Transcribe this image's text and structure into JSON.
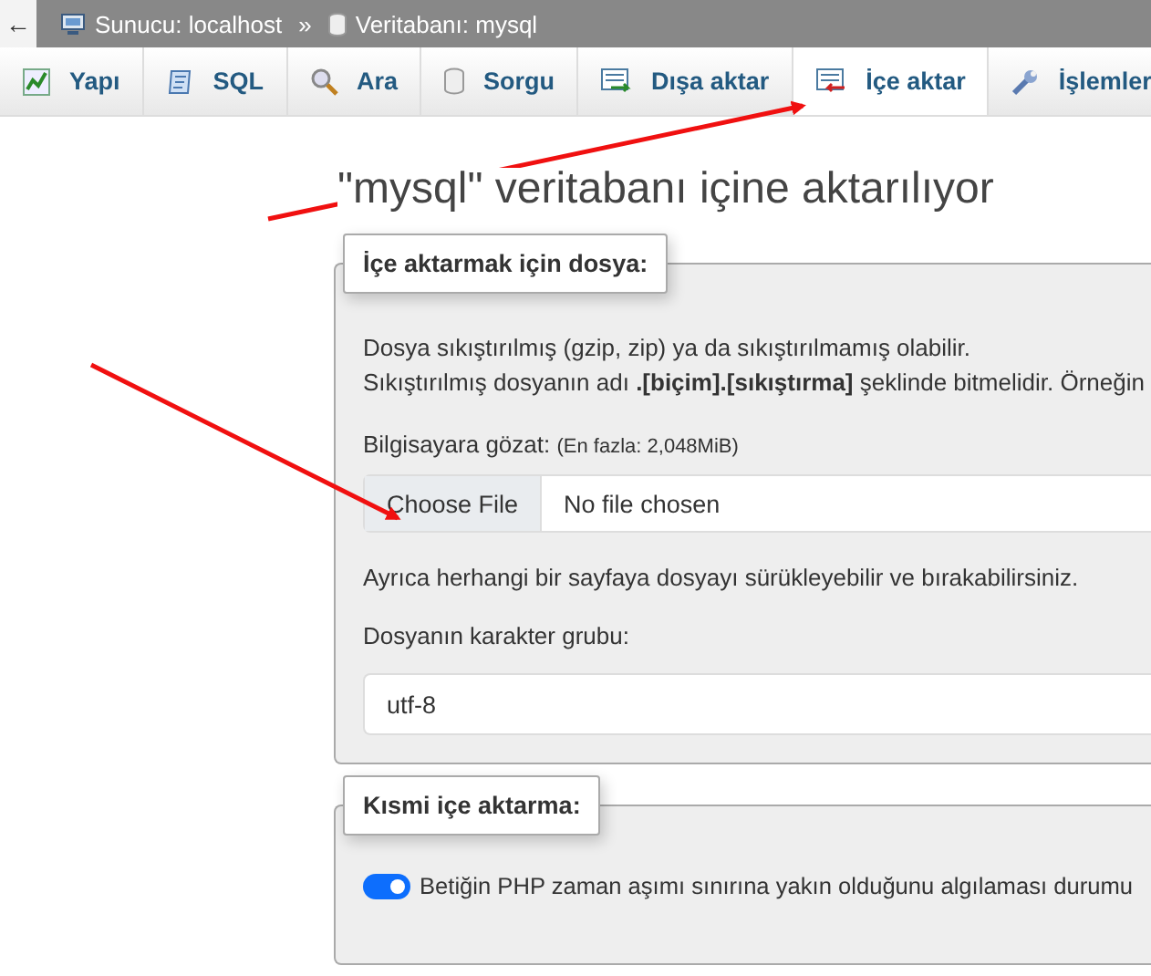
{
  "breadcrumb": {
    "back": "←",
    "server": "Sunucu: localhost",
    "separator": "»",
    "database": "Veritabanı: mysql"
  },
  "tabs": [
    {
      "label": "Yapı",
      "kind": "structure",
      "selected": false
    },
    {
      "label": "SQL",
      "kind": "sql",
      "selected": false
    },
    {
      "label": "Ara",
      "kind": "search",
      "selected": false
    },
    {
      "label": "Sorgu",
      "kind": "query",
      "selected": false
    },
    {
      "label": "Dışa aktar",
      "kind": "export",
      "selected": false
    },
    {
      "label": "İçe aktar",
      "kind": "import",
      "selected": true
    },
    {
      "label": "İşlemler",
      "kind": "operations",
      "selected": false
    }
  ],
  "page_title": "\"mysql\" veritabanı içine aktarılıyor",
  "file_section": {
    "legend": "İçe aktarmak için dosya:",
    "lines": [
      "Dosya sıkıştırılmış (gzip, zip) ya da sıkıştırılmamış olabilir.",
      "Sıkıştırılmış dosyanın adı **.[biçim].[sıkıştırma]** şeklinde bitmelidir. Örneğin"
    ],
    "browse_label": "Bilgisayara gözat:",
    "browse_limit": "(En fazla: 2,048MiB)",
    "choose_button": "Choose File",
    "file_status": "No file chosen",
    "drag_note": "Ayrıca herhangi bir sayfaya dosyayı sürükleyebilir ve bırakabilirsiniz.",
    "charset_label": "Dosyanın karakter grubu:",
    "charset_value": "utf-8"
  },
  "partial_section": {
    "legend": "Kısmi içe aktarma:",
    "toggle": {
      "on": true,
      "label": "Betiğin PHP zaman aşımı sınırına yakın olduğunu algılaması durumu"
    }
  }
}
